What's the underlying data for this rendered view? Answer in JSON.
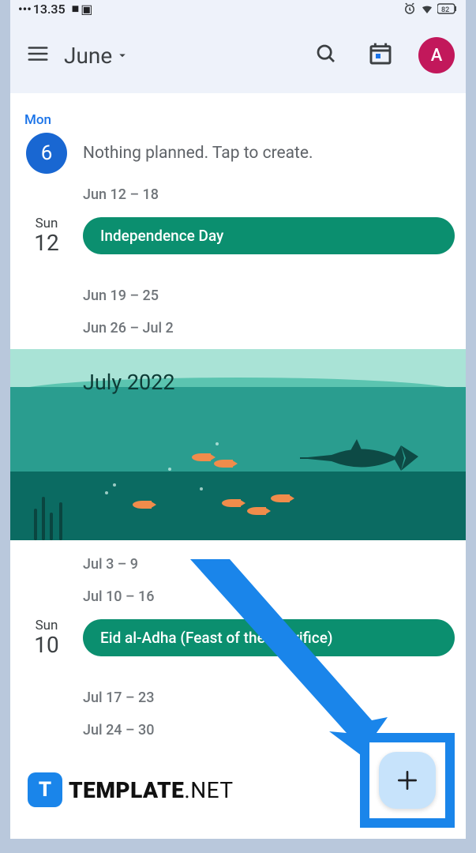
{
  "status": {
    "time": "13.35"
  },
  "topbar": {
    "month_label": "June",
    "avatar_letter": "A"
  },
  "schedule": {
    "today": {
      "weekday": "Mon",
      "day": "6",
      "empty": "Nothing planned. Tap to create."
    },
    "range1": "Jun 12 – 18",
    "sun12": {
      "weekday": "Sun",
      "day": "12",
      "event": "Independence Day"
    },
    "range2": "Jun 19 – 25",
    "range3": "Jun 26 – Jul 2",
    "month_banner": "July 2022",
    "range4": "Jul 3 – 9",
    "range5": "Jul 10 – 16",
    "sun10": {
      "weekday": "Sun",
      "day": "10",
      "event": "Eid al-Adha (Feast of the Sacrifice)"
    },
    "range6": "Jul 17 – 23",
    "range7": "Jul 24 – 30"
  },
  "watermark": {
    "badge": "T",
    "bold": "TEMPLATE",
    "rest": ".NET"
  }
}
